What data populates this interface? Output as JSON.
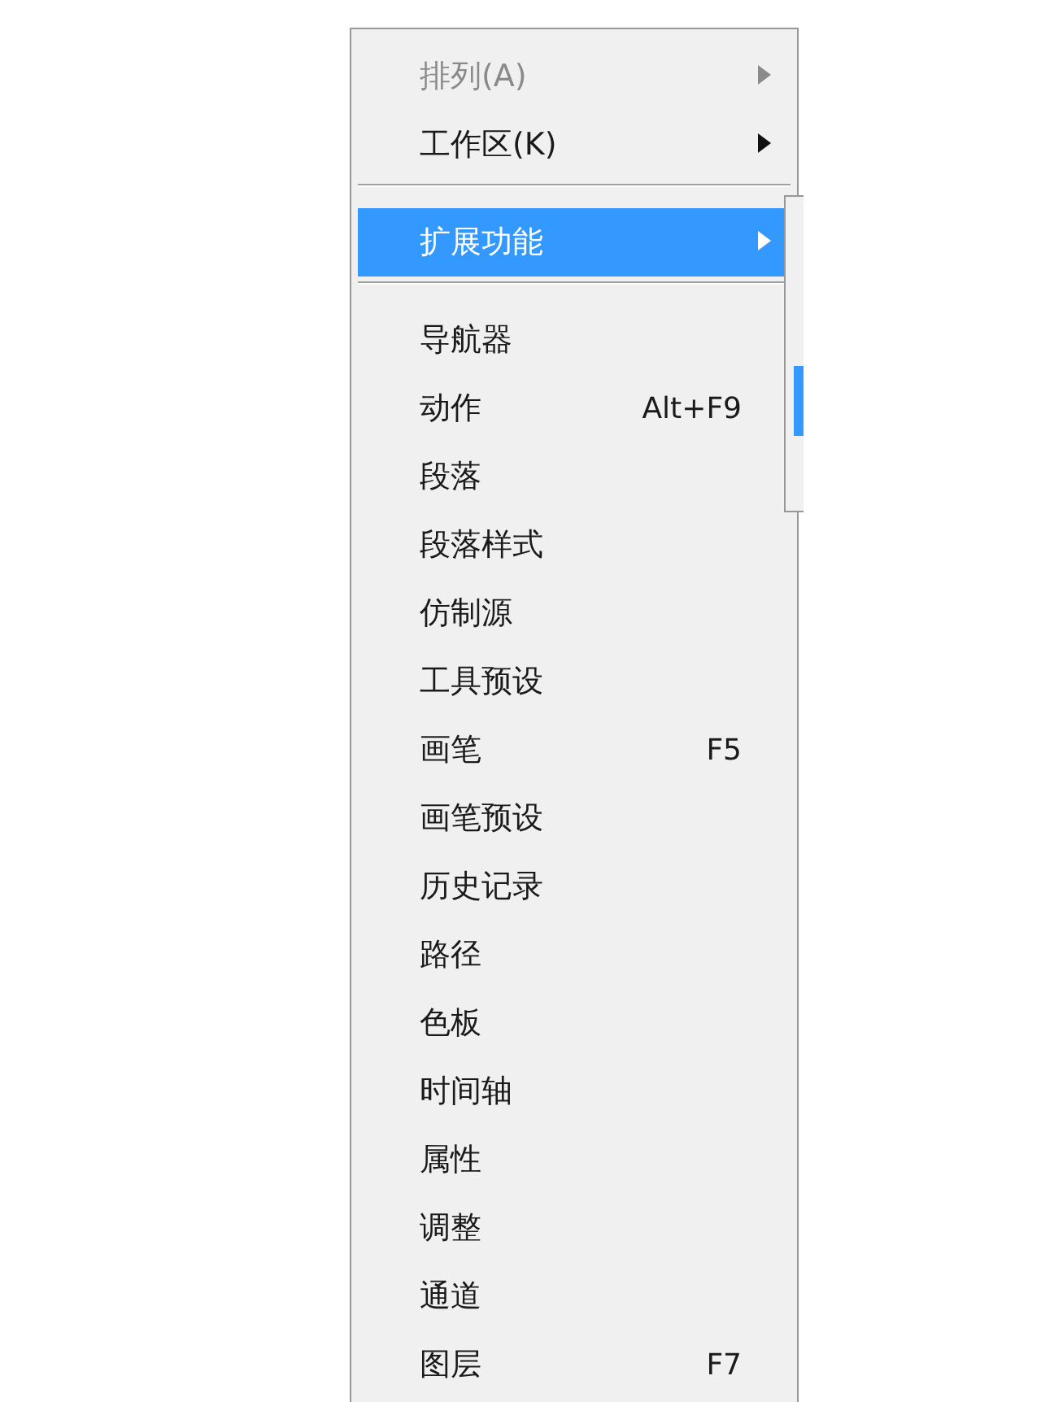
{
  "menu": {
    "items": [
      {
        "kind": "item",
        "label": "排列(A)",
        "submenu": true,
        "disabled": true,
        "selected": false
      },
      {
        "kind": "item",
        "label": "工作区(K)",
        "submenu": true,
        "disabled": false,
        "selected": false
      },
      {
        "kind": "separator"
      },
      {
        "kind": "item",
        "label": "扩展功能",
        "submenu": true,
        "disabled": false,
        "selected": true
      },
      {
        "kind": "separator"
      },
      {
        "kind": "item",
        "label": "导航器",
        "disabled": false,
        "selected": false
      },
      {
        "kind": "item",
        "label": "动作",
        "shortcut": "Alt+F9",
        "disabled": false,
        "selected": false
      },
      {
        "kind": "item",
        "label": "段落",
        "disabled": false,
        "selected": false
      },
      {
        "kind": "item",
        "label": "段落样式",
        "disabled": false,
        "selected": false
      },
      {
        "kind": "item",
        "label": "仿制源",
        "disabled": false,
        "selected": false
      },
      {
        "kind": "item",
        "label": "工具预设",
        "disabled": false,
        "selected": false
      },
      {
        "kind": "item",
        "label": "画笔",
        "shortcut": "F5",
        "disabled": false,
        "selected": false
      },
      {
        "kind": "item",
        "label": "画笔预设",
        "disabled": false,
        "selected": false
      },
      {
        "kind": "item",
        "label": "历史记录",
        "disabled": false,
        "selected": false
      },
      {
        "kind": "item",
        "label": "路径",
        "disabled": false,
        "selected": false
      },
      {
        "kind": "item",
        "label": "色板",
        "disabled": false,
        "selected": false
      },
      {
        "kind": "item",
        "label": "时间轴",
        "disabled": false,
        "selected": false
      },
      {
        "kind": "item",
        "label": "属性",
        "disabled": false,
        "selected": false
      },
      {
        "kind": "item",
        "label": "调整",
        "disabled": false,
        "selected": false
      },
      {
        "kind": "item",
        "label": "通道",
        "disabled": false,
        "selected": false
      },
      {
        "kind": "item",
        "label": "图层",
        "shortcut": "F7",
        "disabled": false,
        "selected": false
      }
    ]
  }
}
